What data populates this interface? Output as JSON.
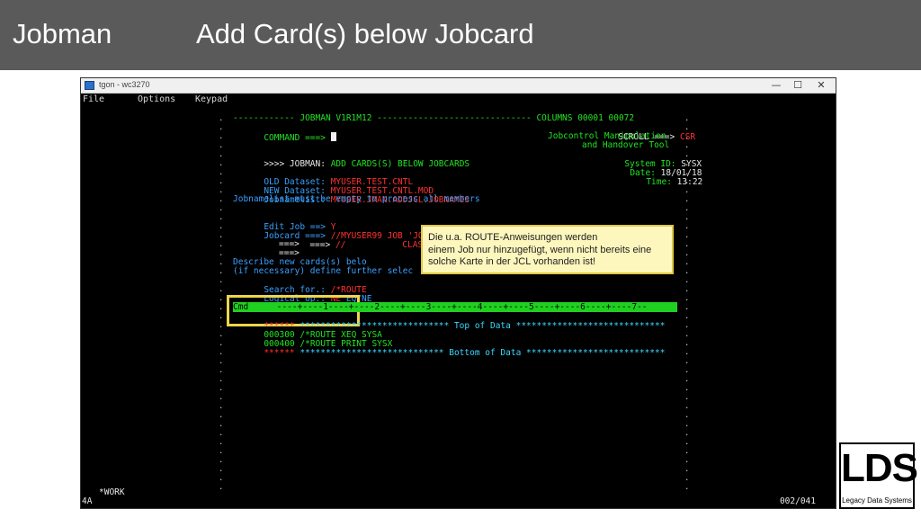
{
  "header": {
    "app_name": "Jobman",
    "title": "Add Card(s) below Jobcard"
  },
  "window": {
    "title": "tgon - wc3270",
    "menu": [
      "File",
      "Options",
      "Keypad"
    ],
    "buttons": {
      "minimize": "—",
      "maximize": "☐",
      "close": "✕"
    }
  },
  "terminal": {
    "line1": "------------ JOBMAN V1R1M12 ------------------------------ COLUMNS 00001 00072",
    "command_label": "COMMAND ===>",
    "scroll_label": "SCROLL ===>",
    "scroll_value": "CSR",
    "tool_line1": "Jobcontrol Manipulation",
    "tool_line2": "and Handover Tool",
    "system_label": "System ID:",
    "system_value": "SYSX",
    "date_label": "Date:",
    "date_value": "18/01/18",
    "time_label": "Time:",
    "time_value": "13:22",
    "jobman_prefix": ">>>> JOBMAN:",
    "jobman_text": "ADD CARDS(S) BELOW JOBCARDS",
    "old_label": "OLD Dataset:",
    "old_value": "MYUSER.TEST.CNTL",
    "new_label": "NEW Dataset:",
    "new_value": "MYUSER.TEST.CNTL.MOD",
    "jnl_label": "Jobnamelist:",
    "jnl_value": "MYUSER.JMAN.ADDJCL.JOBNAMES",
    "jnl_note": "Jobnamelist must be empty to process all members",
    "edit_label": "Edit Job ==>",
    "edit_value": "Y",
    "jobcard_label": "Jobcard ===>",
    "jobcard_value": "//MYUSER99 JOB 'JOBMAN TOOL',",
    "jc2_label": "===>",
    "jc2_value": "//           CLASS=A,NO",
    "jc3_label": "===>",
    "jc4_label": "===>",
    "describe_line": "Describe new cards(s) belo",
    "optional_line": "(if necessary) define further selec",
    "search_label": "Search for.:",
    "search_value": "/*ROUTE",
    "logical_label": "Logical Op.:",
    "logical_value": "NE",
    "logical_options": "EQ/NE",
    "cmd_label": "Cmd",
    "ruler": " ----+----1----+----2----+----3----+----4----+----5----+----6----+----7--",
    "top_stars": "******",
    "top_line": " ***************************** Top of Data *****************************",
    "row1_num": "000300",
    "row1_text": " /*ROUTE XEQ SYSA",
    "row2_num": "000400",
    "row2_text": " /*ROUTE PRINT SYSX",
    "bottom_stars": "******",
    "bottom_line": " **************************** Bottom of Data ***************************",
    "status_work": "*WORK",
    "status_left": "4A",
    "status_right": "002/041"
  },
  "callout": {
    "line1": "Die u.a. ROUTE-Anweisungen werden",
    "line2": "einem Job nur hinzugefügt, wenn nicht bereits eine",
    "line3": "solche Karte in der JCL vorhanden ist!"
  },
  "logo": {
    "main": "LDS",
    "sub": "Legacy Data Systems"
  },
  "colors": {
    "header_bg": "#5a5a5a",
    "terminal_bg": "#000000",
    "green": "#22e322",
    "blue": "#3aa0ff",
    "red": "#ff3030",
    "turquoise": "#3ad8ff",
    "callout_bg": "#fdf6bd",
    "highlight": "#ecd64a"
  }
}
